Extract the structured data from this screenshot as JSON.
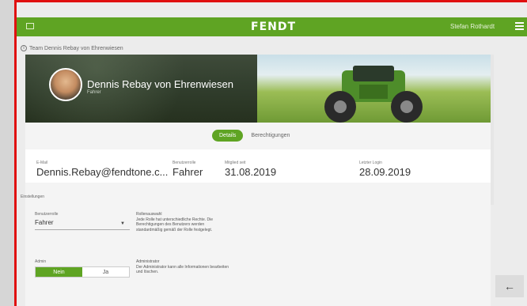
{
  "appbar": {
    "brand": "FENDT",
    "user": "Stefan Rothardt"
  },
  "breadcrumb": {
    "text": "Team Dennis Rebay von Ehrenwiesen"
  },
  "hero": {
    "name": "Dennis Rebay von Ehrenwiesen",
    "role": "Fahrer"
  },
  "tabs": [
    {
      "label": "Details"
    },
    {
      "label": "Berechtigungen"
    }
  ],
  "info": {
    "email_label": "E-Mail",
    "email_value": "Dennis.Rebay@fendtone.c...",
    "role_label": "Benutzerrolle",
    "role_value": "Fahrer",
    "created_label": "Mitglied seit",
    "created_value": "31.08.2019",
    "lastlogin_label": "Letzter Login",
    "lastlogin_value": "28.09.2019"
  },
  "settings": {
    "section_label": "Einstellungen",
    "role_select_label": "Benutzerrolle",
    "role_select_value": "Fahrer",
    "role_help_title": "Rollenauswahl",
    "role_help_text": "Jede Rolle hat unterschiedliche Rechte. Die Berechtigungen des Benutzers werden standardmäßig gemäß der Rolle festgelegt.",
    "admin_label": "Admin",
    "toggle_no": "Nein",
    "toggle_yes": "Ja",
    "admin_help_title": "Administrator",
    "admin_help_text": "Der Administrator kann alle Informationen bearbeiten und löschen."
  },
  "nav": {
    "back_glyph": "←"
  }
}
